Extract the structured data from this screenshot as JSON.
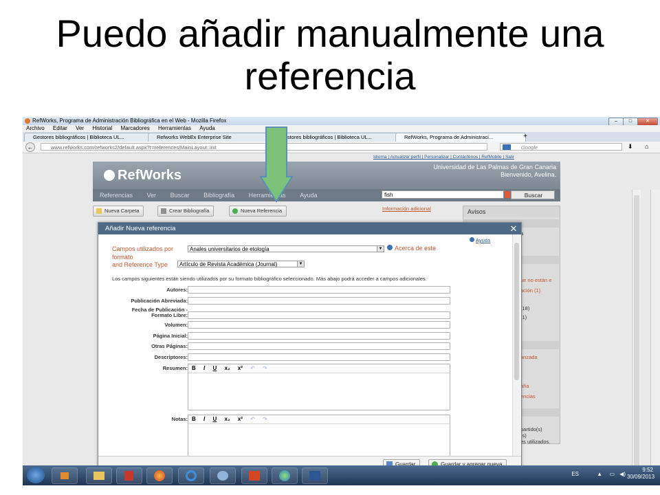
{
  "slide": {
    "title_line1": "Puedo añadir manualmente una",
    "title_line2": "referencia"
  },
  "firefox": {
    "window_title": "RefWorks, Programa de Administración Bibliográfica en el Web - Mozilla Firefox",
    "menu": [
      "Archivo",
      "Editar",
      "Ver",
      "Historial",
      "Marcadores",
      "Herramientas",
      "Ayuda"
    ],
    "tabs": [
      {
        "label": "Gestores bibliográficos | Biblioteca UL...",
        "active": false
      },
      {
        "label": "Refworks WebEx Enterprise Site",
        "active": false
      },
      {
        "label": "Gestores bibliográficos | Biblioteca UL...",
        "active": false
      },
      {
        "label": "RefWorks, Programa de Administraci...",
        "active": true
      }
    ],
    "url": "www.refworks.com/refworks2/default.aspx?r=references|MainLayout::init",
    "search_engine_placeholder": "Google"
  },
  "refworks": {
    "top_links": "Idioma | Actualizar perfil | Personalizar | Contáctenos | RefMobile | Salir",
    "logo": "RefWorks",
    "university": "Universidad de Las Palmas de Gran Canaria",
    "welcome": "Bienvenido, Avelina.",
    "menu": [
      "Referencias",
      "Ver",
      "Buscar",
      "Bibliografía",
      "Herramientas",
      "Ayuda"
    ],
    "search_value": "fish",
    "search_button": "Buscar",
    "toolbar": {
      "nueva_carpeta": "Nueva Carpeta",
      "crear_bibliografia": "Crear Bibliografía",
      "nueva_referencia": "Nueva Referencia"
    },
    "info_adicional": "Información adicional",
    "right_panel": {
      "avisos": "Avisos",
      "snippets": [
        "a",
        "ue no están e",
        "ación (1)",
        "(18)",
        "(1)",
        "anzada",
        "afía",
        "encias",
        "partido(s)",
        "(s)",
        "es utilizados."
      ]
    }
  },
  "modal": {
    "title": "Añadir Nueva referencia",
    "ayuda": "Ayuda",
    "campos_label": "Campos utilizados por",
    "campos_value": "Anales universitarios de etología",
    "acerca_link": "Acerca de este",
    "formato_word": "formato",
    "reftype_label": "and Reference Type",
    "reftype_value": "Artículo de Revista Académica (Journal)",
    "intro": "Los campos siguientes están siendo utilizados por su formato bibliográfico seleccionado. Más abajo podrá acceder a campos adicionales.",
    "fields": {
      "autores": "Autores:",
      "publicacion_abreviada": "Publicación Abreviada:",
      "fecha_1": "Fecha de Publicación -",
      "fecha_2": "Formato Libre:",
      "volumen": "Volumen:",
      "pagina_inicial": "Página Inicial:",
      "otras_paginas": "Otras Páginas:",
      "descriptores": "Descriptores:",
      "resumen": "Resumen:",
      "notas": "Notas:"
    },
    "rte_toolbar": [
      "B",
      "I",
      "U",
      "x₂",
      "x²",
      "↶",
      "↷"
    ],
    "buttons": {
      "guardar": "Guardar",
      "guardar_agregar": "Guardar y agregar nueva"
    }
  },
  "taskbar": {
    "language": "ES",
    "time": "9:52",
    "date": "30/09/2013"
  },
  "colors": {
    "accent_orange": "#c3572f",
    "modal_header": "#4e6a86",
    "arrow_green": "#7cc27a"
  }
}
